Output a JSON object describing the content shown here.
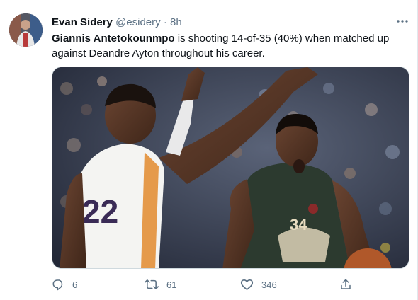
{
  "tweet": {
    "author_name": "Evan Sidery",
    "handle": "@esidery",
    "separator": "·",
    "time": "8h",
    "text_bold": "Giannis Antetokounmpo",
    "text_rest": " is shooting 14-of-35 (40%) when matched up against Deandre Ayton throughout his career.",
    "jersey_left": "22",
    "jersey_right": "34"
  },
  "actions": {
    "replies": "6",
    "retweets": "61",
    "likes": "346"
  },
  "colors": {
    "text": "#0f1419",
    "secondary": "#5b7083",
    "bucks_green": "#2c3a2f",
    "suns_white": "#f4f4f2"
  },
  "icons": [
    "more-icon",
    "reply-icon",
    "retweet-icon",
    "like-icon",
    "share-icon"
  ]
}
